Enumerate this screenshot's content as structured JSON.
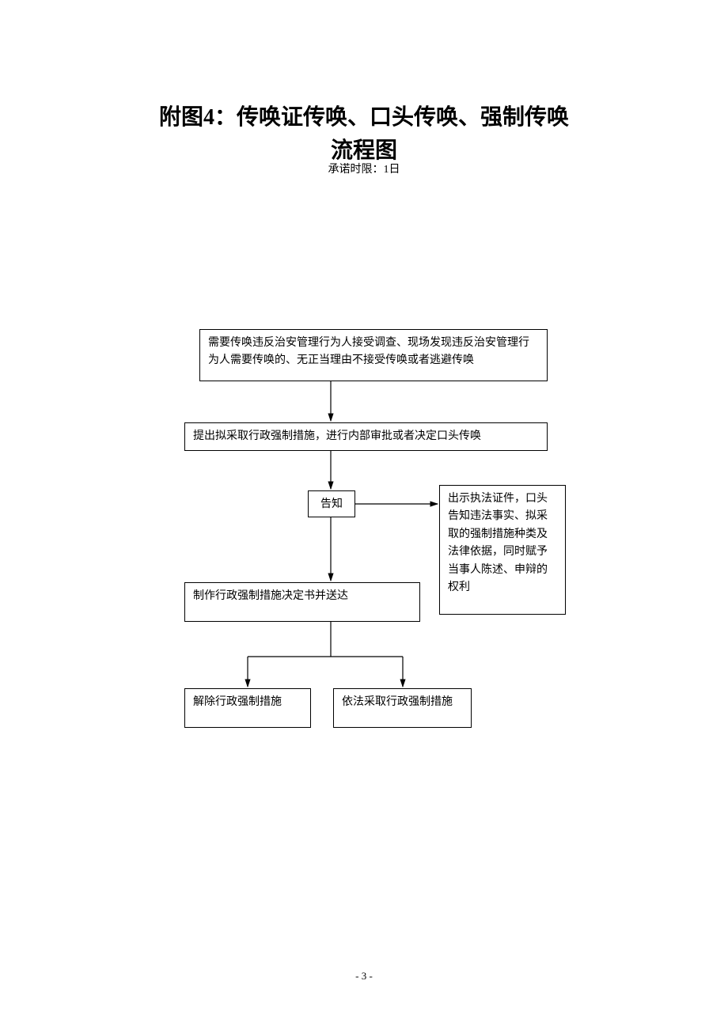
{
  "title_line1": "附图4：传唤证传唤、口头传唤、强制传唤",
  "title_line2": "流程图",
  "subtitle": "承诺时限：1日",
  "nodes": {
    "n1": "需要传唤违反治安管理行为人接受调查、现场发现违反治安管理行为人需要传唤的、无正当理由不接受传唤或者逃避传唤",
    "n2": "提出拟采取行政强制措施，进行内部审批或者决定口头传唤",
    "n3": "告知",
    "n4": "制作行政强制措施决定书并送达",
    "n5": "解除行政强制措施",
    "n6": "依法采取行政强制措施",
    "side": "出示执法证件，口头告知违法事实、拟采取的强制措施种类及法律依据，同时赋予当事人陈述、申辩的权利"
  },
  "chart_data": {
    "type": "flowchart",
    "title": "附图4：传唤证传唤、口头传唤、强制传唤流程图",
    "subtitle": "承诺时限：1日",
    "nodes": [
      {
        "id": "n1",
        "text": "需要传唤违反治安管理行为人接受调查、现场发现违反治安管理行为人需要传唤的、无正当理由不接受传唤或者逃避传唤"
      },
      {
        "id": "n2",
        "text": "提出拟采取行政强制措施，进行内部审批或者决定口头传唤"
      },
      {
        "id": "n3",
        "text": "告知"
      },
      {
        "id": "side",
        "text": "出示执法证件，口头告知违法事实、拟采取的强制措施种类及法律依据，同时赋予当事人陈述、申辩的权利"
      },
      {
        "id": "n4",
        "text": "制作行政强制措施决定书并送达"
      },
      {
        "id": "n5",
        "text": "解除行政强制措施"
      },
      {
        "id": "n6",
        "text": "依法采取行政强制措施"
      }
    ],
    "edges": [
      {
        "from": "n1",
        "to": "n2"
      },
      {
        "from": "n2",
        "to": "n3"
      },
      {
        "from": "n3",
        "to": "side"
      },
      {
        "from": "n3",
        "to": "n4"
      },
      {
        "from": "n4",
        "to": "n5"
      },
      {
        "from": "n4",
        "to": "n6"
      }
    ]
  },
  "page_number": "- 3 -"
}
